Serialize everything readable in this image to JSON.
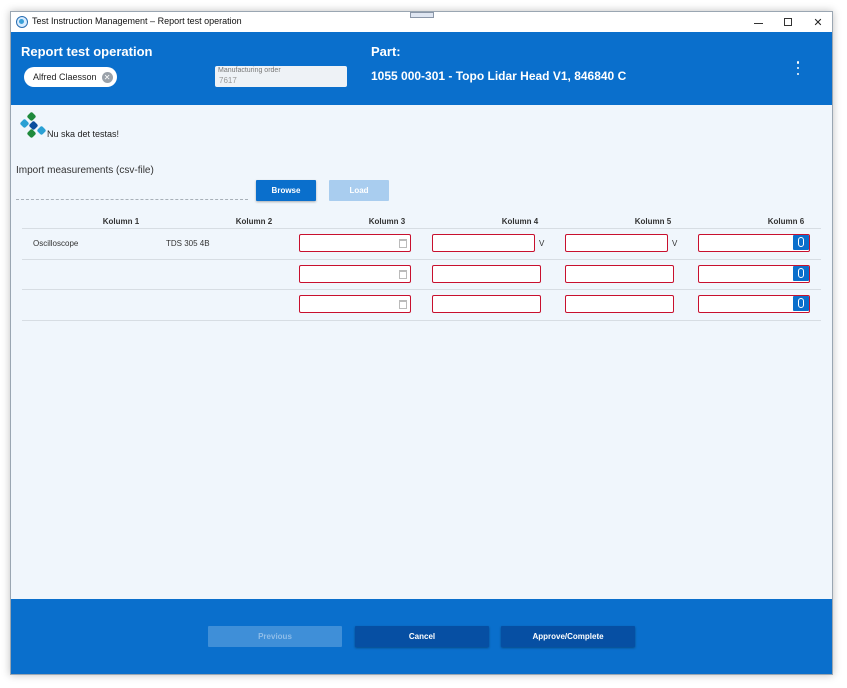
{
  "window": {
    "title": "Test Instruction Management – Report test operation"
  },
  "header": {
    "title": "Report test operation",
    "user_chip": "Alfred Claesson",
    "manufacturing_order": {
      "label": "Manufacturing order",
      "value": "7617"
    },
    "part_label": "Part:",
    "part_value": "1055 000-301 - Topo Lidar Head V1, 846840 C"
  },
  "content": {
    "instruction": "Nu ska det testas!",
    "import_label": "Import measurements (csv-file)",
    "browse_label": "Browse",
    "load_label": "Load"
  },
  "table": {
    "columns": [
      "Kolumn 1",
      "Kolumn 2",
      "Kolumn 3",
      "Kolumn 4",
      "Kolumn 5",
      "Kolumn 6"
    ],
    "rows": [
      {
        "col1": "Oscilloscope",
        "col2": "TDS 305 4B",
        "unit4": "V",
        "unit5": "V"
      },
      {
        "col1": "",
        "col2": "",
        "unit4": "",
        "unit5": ""
      },
      {
        "col1": "",
        "col2": "",
        "unit4": "",
        "unit5": ""
      }
    ]
  },
  "footer": {
    "previous_label": "Previous",
    "cancel_label": "Cancel",
    "approve_label": "Approve/Complete"
  },
  "colors": {
    "primary": "#0a6fcc",
    "dark_primary": "#064fa3",
    "error_border": "#c8102e",
    "background": "#f0f6fc"
  }
}
